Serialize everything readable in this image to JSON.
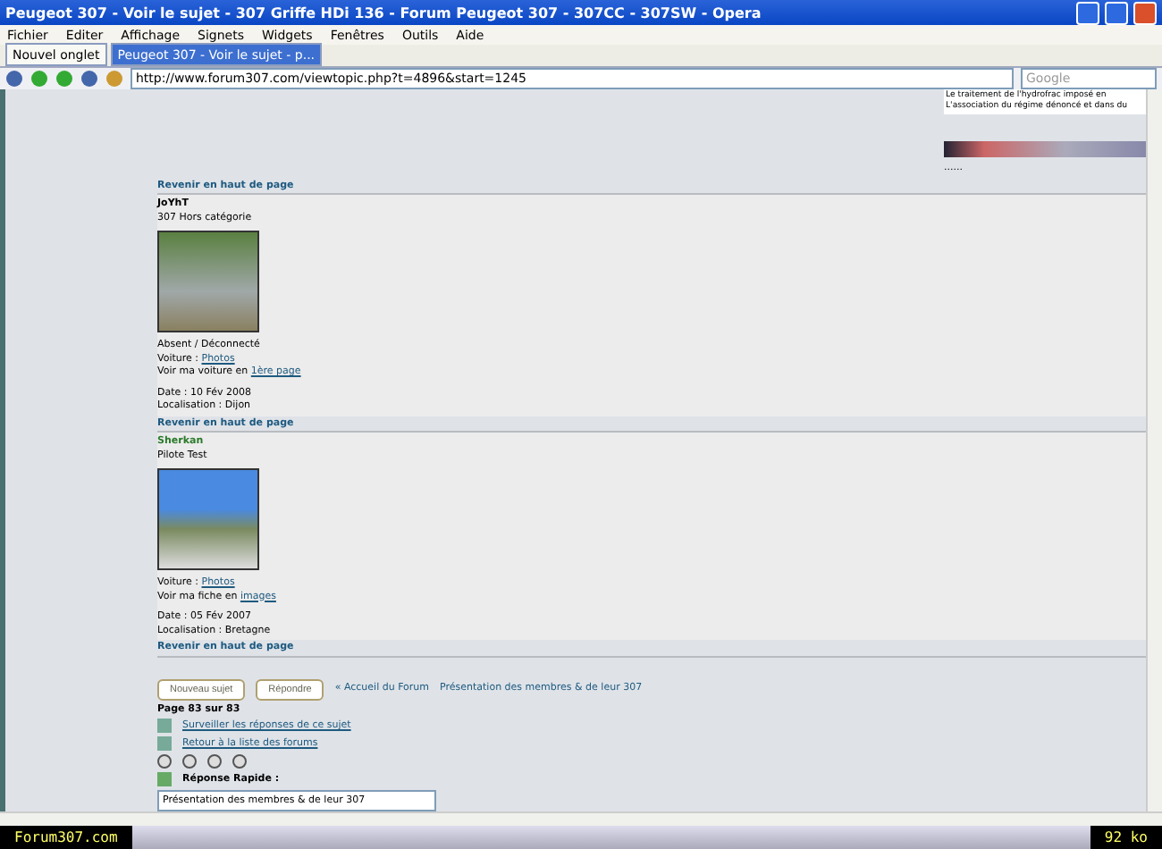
{
  "window": {
    "title": "Peugeot 307 - Voir le sujet - 307 Griffe HDi 136 - Forum Peugeot 307 - 307CC - 307SW - Opera"
  },
  "menu": [
    "Fichier",
    "Editer",
    "Affichage",
    "Signets",
    "Widgets",
    "Fenêtres",
    "Outils",
    "Aide"
  ],
  "tabs": [
    {
      "label": "Nouvel onglet",
      "selected": false
    },
    {
      "label": "Peugeot 307 - Voir le sujet - p...",
      "selected": true
    }
  ],
  "address": {
    "value": "http://www.forum307.com/viewtopic.php?t=4896&start=1245"
  },
  "search": {
    "placeholder": "Google"
  },
  "ad": {
    "lines": [
      "Le traitement de l'hydrofrac imposé en",
      "L'association du régime dénoncé et dans du"
    ],
    "caption": "......"
  },
  "posts": [
    {
      "top_link": "Revenir en haut de page",
      "author": "JoYhT",
      "rank": "307 Hors catégorie",
      "status": "Absent / Déconnecté",
      "car_label": "Voiture :",
      "car_link": "Photos",
      "more_label": "Voir ma voiture en",
      "more_link": "1ère page",
      "date": "Date : 10 Fév 2008",
      "location": "Localisation : Dijon"
    },
    {
      "top_link": "Revenir en haut de page",
      "author": "Sherkan",
      "rank": "Pilote Test",
      "car_label": "Voiture :",
      "car_link": "Photos",
      "more_label": "Voir ma fiche en",
      "more_link": "images",
      "date": "Date : 05 Fév 2007",
      "location": "Localisation : Bretagne"
    }
  ],
  "bottom_link": "Revenir en haut de page",
  "buttons": [
    "Nouveau sujet",
    "Répondre"
  ],
  "breadcrumb": [
    {
      "label": "« Accueil du Forum"
    },
    {
      "label": "Présentation des membres & de leur 307"
    }
  ],
  "page_info": "Page 83 sur 83",
  "links": [
    "Surveiller les réponses de ce sujet",
    "Retour à la liste des forums"
  ],
  "quick_reply": {
    "label": "Réponse Rapide :",
    "value": "Présentation des membres & de leur 307"
  },
  "status_bar": {
    "site": "Forum307.com",
    "size": "92 ko"
  }
}
